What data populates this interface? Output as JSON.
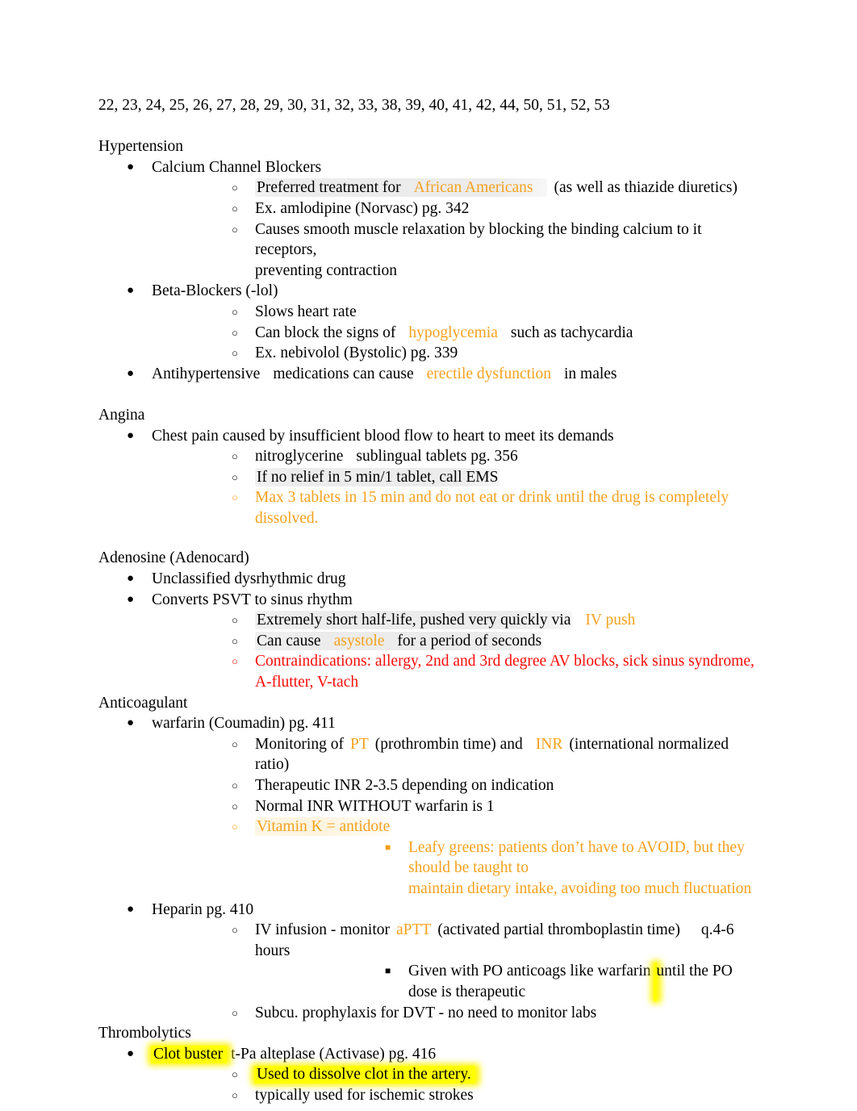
{
  "document": {
    "page_numbers_line": "22, 23, 24, 25, 26, 27, 28, 29, 30, 31, 32, 33, 38, 39, 40, 41, 42, 44, 50, 51, 52, 53",
    "colors": {
      "orange_accent": "#F5A11E",
      "red_accent": "#FA0B07",
      "yellow_highlight": "#FFFF00",
      "grey_highlight": "#EDEAE6",
      "text": "#000000",
      "page_background": "#FFFFFF"
    },
    "bullet_glyphs": {
      "level1": "●",
      "level2": "○",
      "level3": "■"
    }
  },
  "sections": {
    "hypertension": {
      "heading": "Hypertension",
      "ccb": {
        "label": "Calcium Channel Blockers",
        "preferred_pre": "Preferred treatment for",
        "preferred_highlight": "African Americans",
        "preferred_post": "(as well as thiazide diuretics)",
        "example": "Ex. amlodipine (Norvasc) pg. 342",
        "mechanism_line1": "Causes smooth muscle relaxation by blocking the binding calcium to it receptors,",
        "mechanism_line2": "preventing contraction"
      },
      "beta_blockers": {
        "label": "Beta-Blockers (-lol)",
        "slows_hr": "Slows heart rate",
        "block_signs_pre": "Can block the signs of",
        "block_signs_highlight": "hypoglycemia",
        "block_signs_post": "such as tachycardia",
        "example": "Ex. nebivolol (Bystolic) pg. 339"
      },
      "antihypertensive": {
        "pre": "Antihypertensive",
        "mid": "medications can cause",
        "highlight": "erectile dysfunction",
        "post": "in males"
      }
    },
    "angina": {
      "heading": "Angina",
      "chest_pain": "Chest pain caused by insufficient blood flow to heart to meet its demands",
      "nitro_drug": "nitroglycerine",
      "nitro_rest": "sublingual tablets pg. 356",
      "ems": "If no relief in 5 min/1 tablet, call EMS",
      "max_tablets_line1": "Max 3 tablets in 15 min and do not eat or drink until the drug is completely",
      "max_tablets_line2": "dissolved."
    },
    "adenosine": {
      "heading": "Adenosine (Adenocard)",
      "unclassified": "Unclassified dysrhythmic drug",
      "converts": "Converts PSVT to sinus rhythm",
      "half_life_pre": "Extremely short half-life, pushed very quickly via",
      "half_life_highlight": "IV push",
      "asystole_pre": "Can cause",
      "asystole_highlight": "asystole",
      "asystole_post": "for a period of seconds",
      "contraindications_line1": "Contraindications: allergy, 2nd and 3rd degree AV blocks, sick sinus syndrome,",
      "contraindications_line2": "A-flutter, V-tach"
    },
    "anticoagulant": {
      "heading": "Anticoagulant",
      "warfarin": {
        "label": "warfarin (Coumadin) pg. 411",
        "monitoring_pre": "Monitoring of",
        "monitoring_pt": "PT",
        "monitoring_mid": "(prothrombin time) and",
        "monitoring_inr": "INR",
        "monitoring_post": "(international normalized ratio)",
        "therapeutic": "Therapeutic INR 2-3.5 depending on indication",
        "normal": "Normal INR  WITHOUT warfarin is 1",
        "vitamin_k": "Vitamin K = antidote",
        "leafy_line1": "Leafy greens: patients don’t have to AVOID, but they should be taught to",
        "leafy_line2": "maintain dietary intake, avoiding too much fluctuation"
      },
      "heparin": {
        "label": "Heparin pg. 410",
        "iv_pre": "IV infusion - monitor",
        "iv_aptt": "aPTT",
        "iv_mid": "(activated partial thromboplastin time)",
        "iv_freq": "q.4-6 hours",
        "given_pre": "Given  with  PO anticoags like warfarin",
        "given_highlight": "until the PO dose is therapeutic",
        "subcu": "Subcu. prophylaxis for DVT - no need to monitor labs"
      }
    },
    "thrombolytics": {
      "heading": "Thrombolytics",
      "clot_buster_highlight": "Clot buster",
      "clot_buster_rest": "t-Pa  alteplase (Activase) pg. 416",
      "dissolve": "Used to dissolve clot in the artery.",
      "ischemic": "typically used for ischemic strokes"
    }
  }
}
